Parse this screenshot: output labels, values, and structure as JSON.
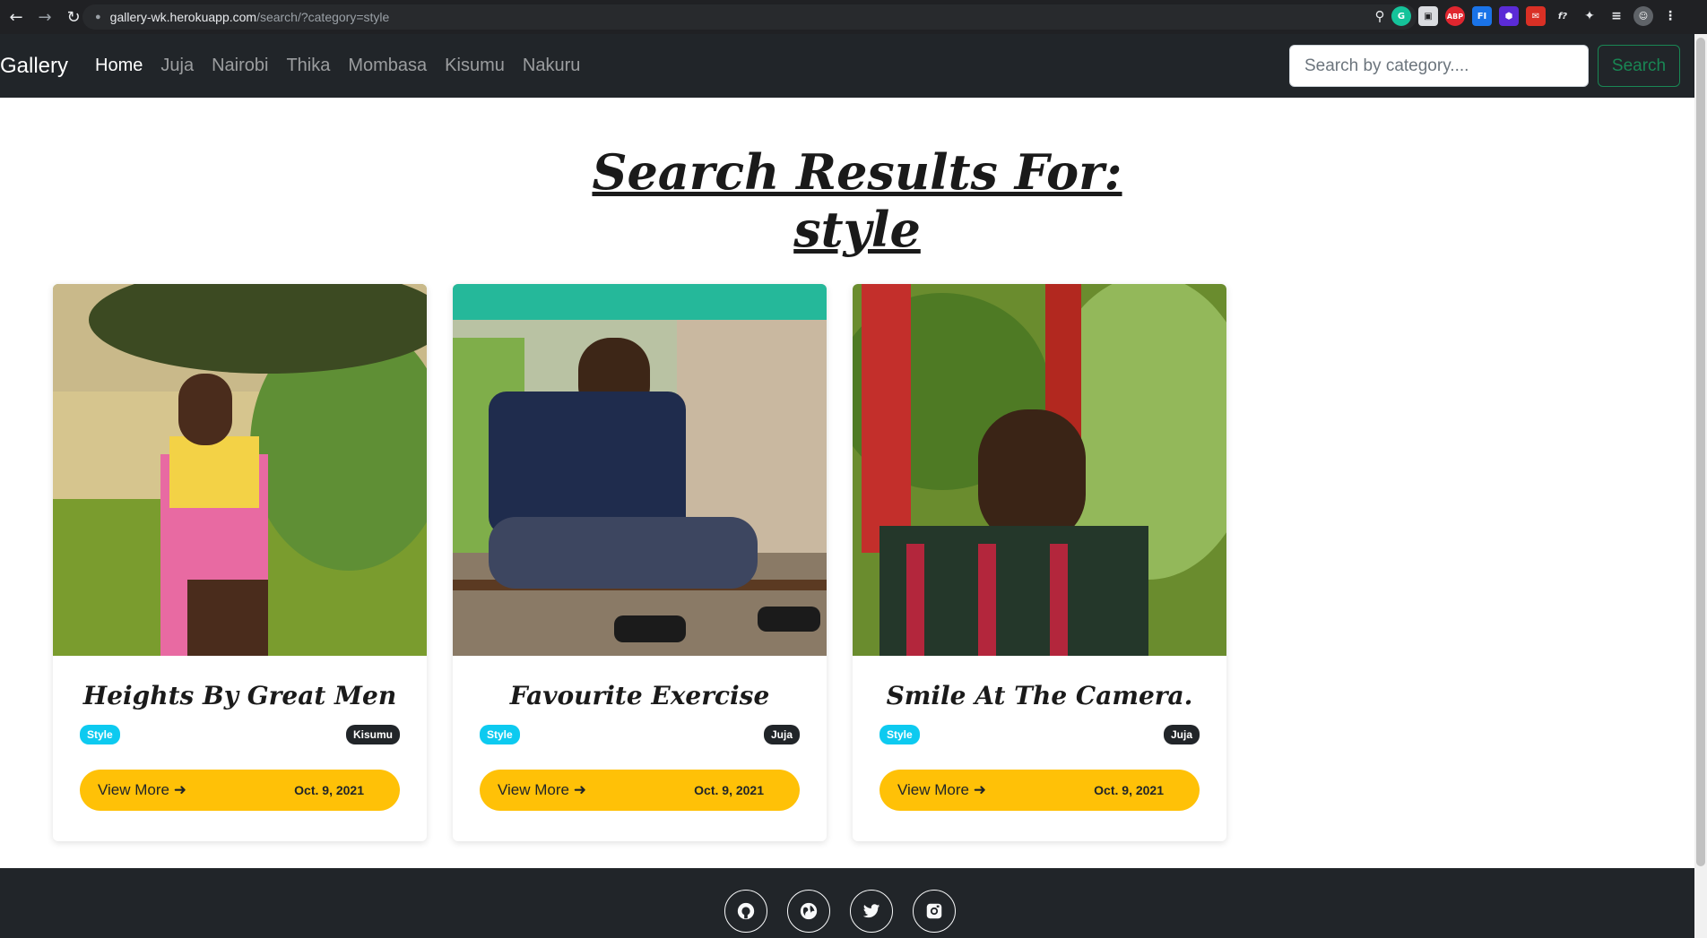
{
  "browser": {
    "url_host": "gallery-wk.herokuapp.com",
    "url_path": "/search/?category=style"
  },
  "navbar": {
    "brand": "Gallery",
    "links": [
      "Home",
      "Juja",
      "Nairobi",
      "Thika",
      "Mombasa",
      "Kisumu",
      "Nakuru"
    ],
    "search_placeholder": "Search by category....",
    "search_button": "Search"
  },
  "heading": {
    "line1": "Search Results For:",
    "line2": "style"
  },
  "cards": [
    {
      "title": "Heights By Great Men",
      "category": "Style",
      "location": "Kisumu",
      "button": "View More",
      "date": "Oct. 9, 2021"
    },
    {
      "title": "Favourite Exercise",
      "category": "Style",
      "location": "Juja",
      "button": "View More",
      "date": "Oct. 9, 2021"
    },
    {
      "title": "Smile At The Camera.",
      "category": "Style",
      "location": "Juja",
      "button": "View More",
      "date": "Oct. 9, 2021"
    }
  ],
  "footer": {
    "icons": [
      "github-icon",
      "globe-icon",
      "twitter-icon",
      "instagram-icon"
    ]
  },
  "colors": {
    "navbar_bg": "#212529",
    "accent_yellow": "#ffc107",
    "badge_cyan": "#0dcaf0",
    "search_green": "#198754"
  }
}
